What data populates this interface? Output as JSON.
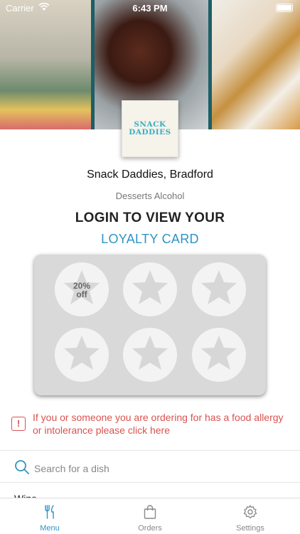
{
  "status_bar": {
    "carrier": "Carrier",
    "time": "6:43 PM"
  },
  "hero": {
    "images": [
      "drinks-photo",
      "donuts-photo",
      "cannoli-photo"
    ]
  },
  "restaurant": {
    "logo_line1": "SNACK",
    "logo_line2": "DADDIES",
    "name": "Snack Daddies, Bradford",
    "tags": "Desserts Alcohol"
  },
  "loyalty": {
    "heading": "LOGIN TO VIEW YOUR",
    "link": "LOYALTY CARD",
    "offer_line1": "20%",
    "offer_line2": "off",
    "stamps_total": 6
  },
  "allergy": {
    "text": "If you or someone you are ordering for has a food allergy or intolerance please click here",
    "icon": "exclamation-icon"
  },
  "search": {
    "placeholder": "Search for a dish"
  },
  "menu_peek": {
    "first_category": "Wine"
  },
  "tabs": [
    {
      "label": "Menu",
      "icon": "fork-knife-icon",
      "active": true
    },
    {
      "label": "Orders",
      "icon": "bag-icon",
      "active": false
    },
    {
      "label": "Settings",
      "icon": "gear-icon",
      "active": false
    }
  ],
  "colors": {
    "accent": "#2f93c6",
    "warning": "#d9534f",
    "card_bg": "#d9d9d9"
  }
}
